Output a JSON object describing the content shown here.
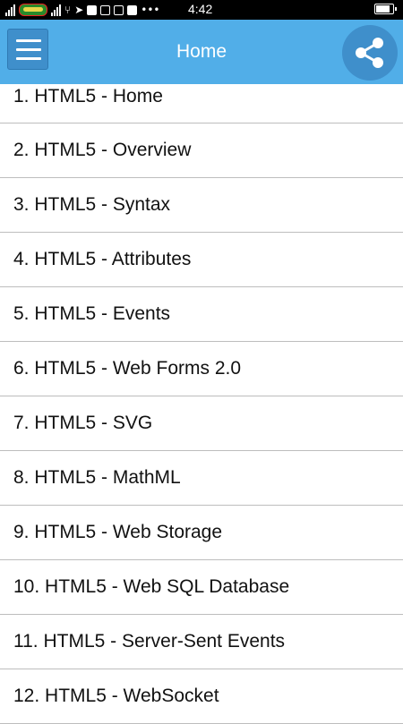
{
  "status_bar": {
    "time": "4:42",
    "icons": [
      "signal-icon",
      "carrier-logo-icon",
      "signal-icon",
      "network-icon",
      "location-icon",
      "youtube-icon",
      "instagram-icon",
      "gmail-icon",
      "zalo-icon",
      "more-icon"
    ],
    "battery_level": 0.9
  },
  "app_bar": {
    "title": "Home",
    "colors": {
      "background": "#51aee8",
      "button": "#3f8fcb"
    }
  },
  "chapters": [
    {
      "label": "1. HTML5 - Home"
    },
    {
      "label": "2. HTML5 - Overview"
    },
    {
      "label": "3. HTML5 - Syntax"
    },
    {
      "label": "4. HTML5 - Attributes"
    },
    {
      "label": "5. HTML5 - Events"
    },
    {
      "label": "6. HTML5 - Web Forms 2.0"
    },
    {
      "label": "7. HTML5 - SVG"
    },
    {
      "label": "8. HTML5 - MathML"
    },
    {
      "label": "9. HTML5 - Web Storage"
    },
    {
      "label": "10. HTML5 - Web SQL Database"
    },
    {
      "label": "11. HTML5 - Server-Sent Events"
    },
    {
      "label": "12. HTML5 - WebSocket"
    }
  ]
}
